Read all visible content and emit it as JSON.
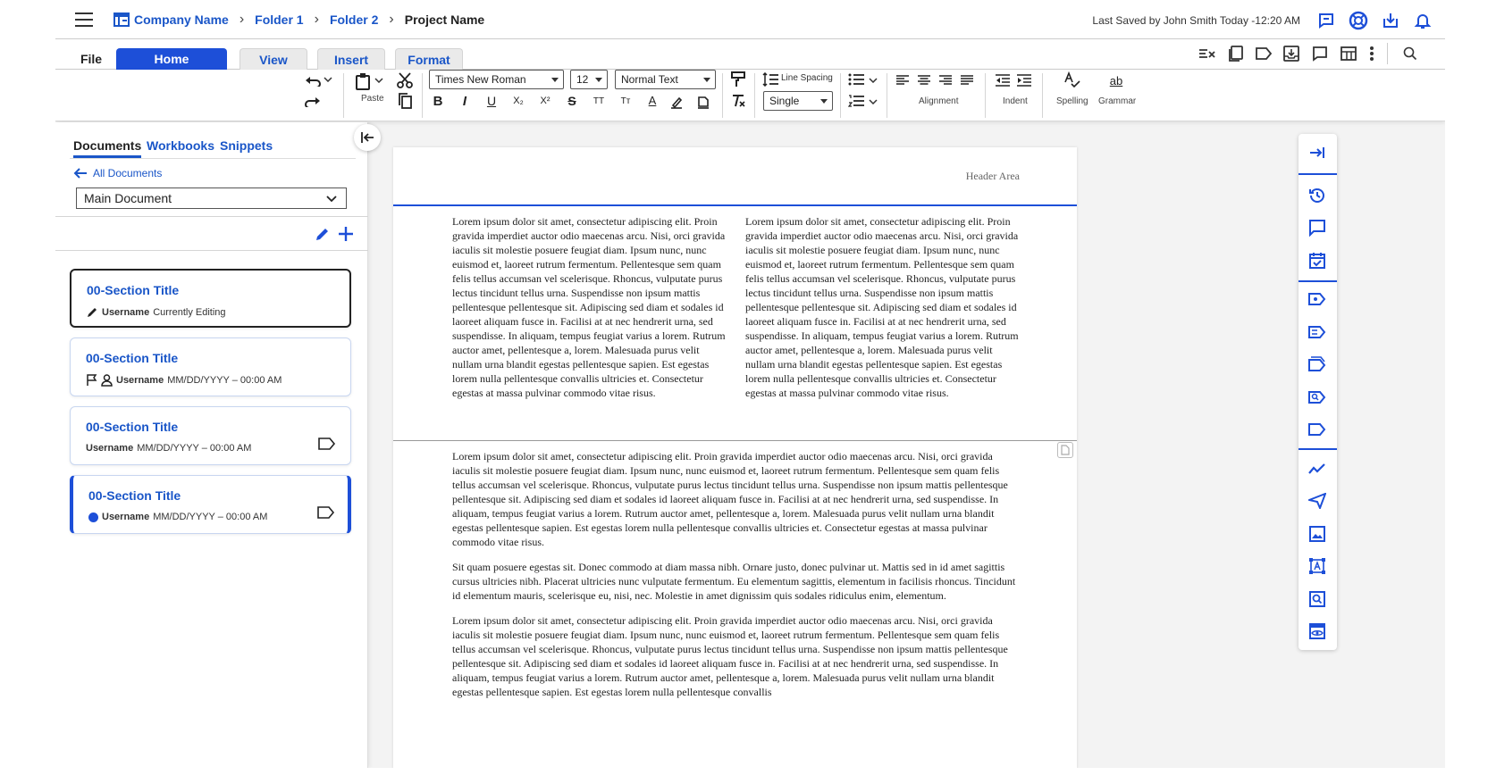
{
  "breadcrumb": {
    "company": "Company Name",
    "folder1": "Folder 1",
    "folder2": "Folder 2",
    "project": "Project Name"
  },
  "saved_status": "Last Saved by John Smith Today -12:20 AM",
  "tabs": {
    "file": "File",
    "home": "Home",
    "view": "View",
    "insert": "Insert",
    "format": "Format"
  },
  "ribbon": {
    "paste_label": "Paste",
    "font_family": "Times New Roman",
    "font_size": "12",
    "paragraph_style": "Normal Text",
    "line_spacing_label": "Line Spacing",
    "line_spacing_value": "Single",
    "alignment_label": "Alignment",
    "indent_label": "Indent",
    "spelling_label": "Spelling",
    "grammar_label": "Grammar",
    "grammar_glyph": "ab",
    "bold": "B",
    "italic": "I",
    "underline": "U",
    "subscript": "X₂",
    "superscript": "X²",
    "strike": "S",
    "tt": "TT",
    "tt2": "Tт",
    "font_color": "A"
  },
  "sidebar": {
    "tabs": [
      "Documents",
      "Workbooks",
      "Snippets"
    ],
    "back_label": "All Documents",
    "document_select": "Main Document",
    "cards": [
      {
        "title": "00-Section Title",
        "user": "Username",
        "meta": "Currently Editing"
      },
      {
        "title": "00-Section Title",
        "user": "Username",
        "meta": "MM/DD/YYYY  –  00:00 AM"
      },
      {
        "title": "00-Section Title",
        "user": "Username",
        "meta": "MM/DD/YYYY  –  00:00 AM"
      },
      {
        "title": "00-Section Title",
        "user": "Username",
        "meta": "MM/DD/YYYY  –  00:00 AM"
      }
    ]
  },
  "document": {
    "header_area": "Header Area",
    "col_text": "Lorem ipsum dolor sit amet, consectetur adipiscing elit. Proin gravida imperdiet auctor odio maecenas arcu. Nisi, orci gravida iaculis sit molestie posuere feugiat diam. Ipsum nunc, nunc euismod et, laoreet rutrum fermentum. Pellentesque sem quam felis tellus accumsan vel scelerisque. Rhoncus, vulputate purus lectus tincidunt tellus urna. Suspendisse non ipsum mattis pellentesque pellentesque sit. Adipiscing sed diam et sodales id laoreet aliquam fusce in. Facilisi at at nec hendrerit urna, sed suspendisse. In aliquam, tempus feugiat varius a lorem. Rutrum auctor amet, pellentesque a, lorem. Malesuada purus velit nullam urna blandit egestas pellentesque sapien. Est egestas lorem nulla pellentesque convallis ultricies et. Consectetur egestas at massa pulvinar commodo vitae risus.",
    "para1": "Lorem ipsum dolor sit amet, consectetur adipiscing elit. Proin gravida imperdiet auctor odio maecenas arcu. Nisi, orci gravida iaculis sit molestie posuere feugiat diam. Ipsum nunc, nunc euismod et, laoreet rutrum fermentum. Pellentesque sem quam felis tellus accumsan vel scelerisque. Rhoncus, vulputate purus lectus tincidunt tellus urna. Suspendisse non ipsum mattis pellentesque pellentesque sit. Adipiscing sed diam et sodales id laoreet aliquam fusce in. Facilisi at at nec hendrerit urna, sed suspendisse. In aliquam, tempus feugiat varius a lorem. Rutrum auctor amet, pellentesque a, lorem. Malesuada purus velit nullam urna blandit egestas pellentesque sapien. Est egestas lorem nulla pellentesque convallis ultricies et. Consectetur egestas at massa pulvinar commodo vitae risus.",
    "para2": "Sit quam posuere egestas sit. Donec commodo at diam massa nibh. Ornare justo, donec pulvinar ut. Mattis sed in id amet sagittis cursus ultricies nibh. Placerat ultricies nunc vulputate fermentum. Eu elementum sagittis, elementum in facilisis rhoncus. Tincidunt id elementum mauris, scelerisque eu, nisi, nec. Molestie in amet dignissim quis sodales ridiculus enim, elementum.",
    "para3": "Lorem ipsum dolor sit amet, consectetur adipiscing elit. Proin gravida imperdiet auctor odio maecenas arcu. Nisi, orci gravida iaculis sit molestie posuere feugiat diam. Ipsum nunc, nunc euismod et, laoreet rutrum fermentum. Pellentesque sem quam felis tellus accumsan vel scelerisque. Rhoncus, vulputate purus lectus tincidunt tellus urna. Suspendisse non ipsum mattis pellentesque pellentesque sit. Adipiscing sed diam et sodales id laoreet aliquam fusce in. Facilisi at at nec hendrerit urna, sed suspendisse. In aliquam, tempus feugiat varius a lorem. Rutrum auctor amet, pellentesque a, lorem. Malesuada purus velit nullam urna blandit egestas pellentesque sapien. Est egestas lorem nulla pellentesque convallis"
  },
  "colors": {
    "accent": "#1d4fd8",
    "link": "#1a56c8"
  }
}
